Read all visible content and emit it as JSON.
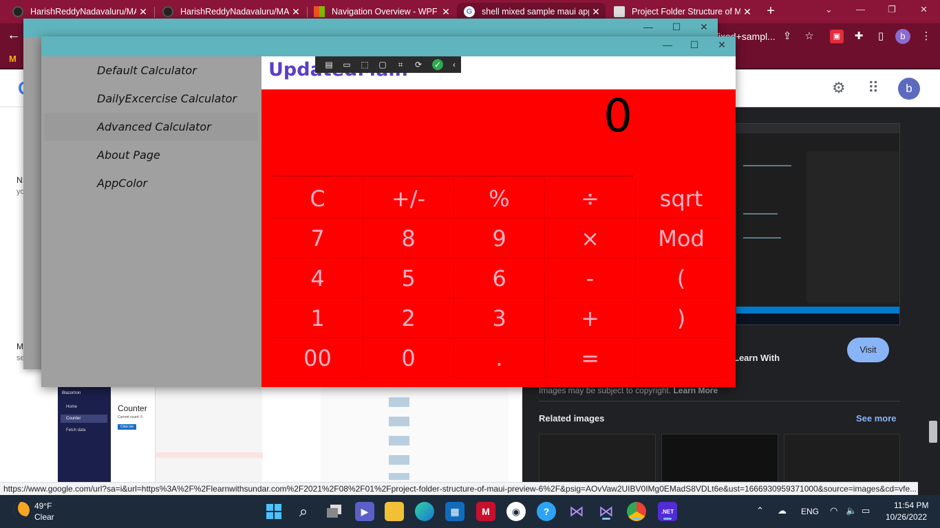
{
  "browser": {
    "tabs": [
      {
        "title": "HarishReddyNadavaluru/MA",
        "active": false
      },
      {
        "title": "HarishReddyNadavaluru/MA",
        "active": false
      },
      {
        "title": "Navigation Overview - WPF",
        "active": false
      },
      {
        "title": "shell mixed sample maui app",
        "active": true
      },
      {
        "title": "Project Folder Structure of M",
        "active": false
      }
    ],
    "new_tab": "+",
    "address_fragment": "fixed+sampl...",
    "profile_initial": "b",
    "bookmark_icon": "M"
  },
  "google": {
    "logo_letter": "G",
    "avatar_initial": "b",
    "left_snippets": [
      "N",
      "yo",
      "M",
      "se"
    ],
    "panel_title": "6) – Learn With",
    "visit_label": "Visit",
    "copyright_text": "Images may be subject to copyright.",
    "learn_more": "Learn More",
    "related_heading": "Related images",
    "see_more": "See more",
    "thumb_counter_title": "Counter",
    "thumb_counter_value": "Current count: 0",
    "thumb_click": "Click me",
    "thumb_nav": [
      "Home",
      "Counter",
      "Fetch data"
    ],
    "thumb_blazor": "Blazortron"
  },
  "status_url": "https://www.google.com/url?sa=i&url=https%3A%2F%2Flearnwithsundar.com%2F2021%2F08%2F01%2Fproject-folder-structure-of-maui-preview-6%2F&psig=AOvVaw2UIBV0IMg0EMadS8VDLt6e&ust=1666930959371000&source=images&cd=vfe...",
  "app": {
    "nav_title": "UpdatedMain",
    "display": "0",
    "flyout": [
      {
        "label": "Default Calculator",
        "selected": false
      },
      {
        "label": "DailyExcercise Calculator",
        "selected": false
      },
      {
        "label": "Advanced Calculator",
        "selected": true
      },
      {
        "label": "About Page",
        "selected": false
      },
      {
        "label": "AppColor",
        "selected": false
      }
    ],
    "keys": [
      [
        "C",
        "+/-",
        "%",
        "÷",
        "sqrt"
      ],
      [
        "7",
        "8",
        "9",
        "×",
        "Mod"
      ],
      [
        "4",
        "5",
        "6",
        "-",
        "("
      ],
      [
        "1",
        "2",
        "3",
        "+",
        ")"
      ],
      [
        "00",
        "0",
        ".",
        "=",
        ""
      ]
    ],
    "window_controls": [
      "—",
      "☐",
      "✕"
    ],
    "colors": {
      "content_bg": "#ff0000",
      "title_bar": "#5fb4bd",
      "nav_title": "#5b3fc4",
      "key_text": "#f8b2c4"
    }
  },
  "taskbar": {
    "temperature": "49°F",
    "condition": "Clear",
    "language": "ENG",
    "time": "11:54 PM",
    "date": "10/26/2022",
    "net_badge": ".NET"
  }
}
